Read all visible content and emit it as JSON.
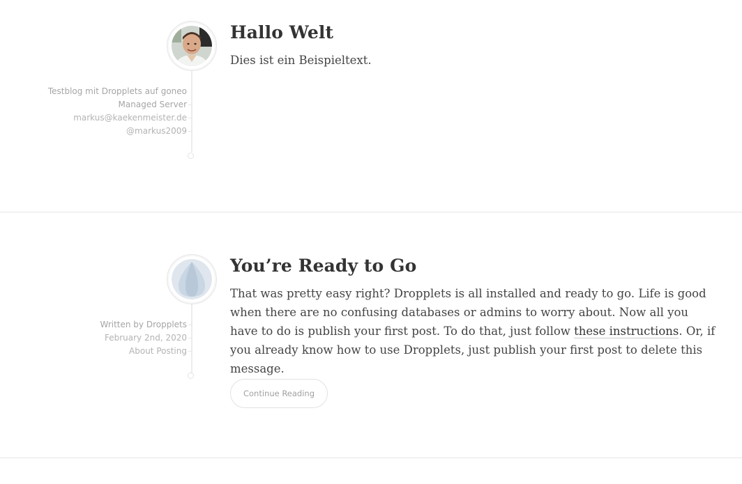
{
  "posts": [
    {
      "title": "Hallo Welt",
      "body": "Dies ist ein Beispieltext.",
      "meta": [
        "Testblog mit Dropplets auf goneo",
        "Managed Server",
        "markus@kaekenmeister.de",
        "@markus2009"
      ],
      "avatar": "author-photo"
    },
    {
      "title": "You’re Ready to Go",
      "body_before_link": "That was pretty easy right? Dropplets is all installed and ready to go. Life is good when there are no confusing databases or admins to worry about. Now all you have to do is publish your first post. To do that, just follow ",
      "link_text": "these instructions",
      "body_after_link": ". Or, if you already know how to use Dropplets, just publish your first post to delete this message.",
      "meta": [
        "Written by Dropplets",
        "February 2nd, 2020",
        "About Posting"
      ],
      "avatar": "dropplets-logo",
      "button_label": "Continue Reading"
    }
  ],
  "colors": {
    "accent_logo": "#c9d6e3",
    "divider": "#e6e6e6",
    "meta_text": "#b3b3b3"
  }
}
